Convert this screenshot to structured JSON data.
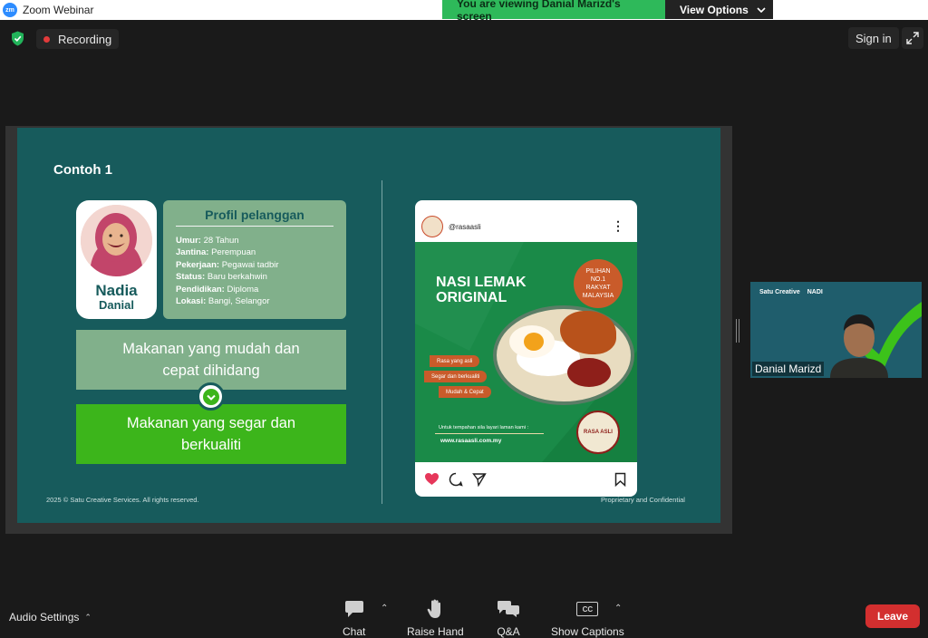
{
  "window": {
    "title": "Zoom Webinar",
    "logo_text": "zm"
  },
  "banner": {
    "viewing_text": "You are viewing Danial Marizd's screen",
    "view_options_label": "View Options"
  },
  "topbar": {
    "recording_label": "Recording",
    "signin_label": "Sign in"
  },
  "slide": {
    "title": "Contoh 1",
    "persona": {
      "first_name": "Nadia",
      "last_name": "Danial"
    },
    "profile": {
      "heading": "Profil pelanggan",
      "rows": [
        {
          "label": "Umur:",
          "value": "28 Tahun"
        },
        {
          "label": "Jantina:",
          "value": "Perempuan"
        },
        {
          "label": "Pekerjaan:",
          "value": "Pegawai tadbir"
        },
        {
          "label": "Status:",
          "value": "Baru berkahwin"
        },
        {
          "label": "Pendidikan:",
          "value": "Diploma"
        },
        {
          "label": "Lokasi:",
          "value": "Bangi, Selangor"
        }
      ]
    },
    "box_before": "Makanan yang mudah dan cepat dihidang",
    "box_after": "Makanan yang segar dan berkualiti",
    "copyright": "2025 © Satu Creative Services. All rights reserved.",
    "proprietary": "Proprietary and Confidential",
    "post": {
      "username": "@rasaasli",
      "title_line1": "NASI LEMAK",
      "title_line2": "ORIGINAL",
      "badge": "PILIHAN NO.1 RAKYAT MALAYSIA",
      "tags": [
        "Rasa yang asli",
        "Segar dan berkualiti",
        "Mudah & Cepat"
      ],
      "order_text": "Untuk tempahan sila layari laman kami :",
      "url": "www.rasaasli.com.my",
      "stamp": "RASA ASLI"
    }
  },
  "participant": {
    "name": "Danial Marizd",
    "logos": [
      "Satu Creative",
      "NADI"
    ]
  },
  "toolbar": {
    "audio_settings": "Audio Settings",
    "chat": "Chat",
    "raise_hand": "Raise Hand",
    "qa": "Q&A",
    "captions": "Show Captions",
    "captions_icon_text": "CC",
    "leave": "Leave"
  },
  "colors": {
    "accent_green": "#2eb95a",
    "slide_teal": "#175b5c",
    "box_sage": "#81b08b",
    "box_green": "#3cb51b",
    "leave_red": "#d32f2f",
    "post_green": "#1a8a48",
    "post_orange": "#c95b2a"
  },
  "icons": [
    "shield-check-icon",
    "fullscreen-icon",
    "chat-icon",
    "hand-icon",
    "qa-icon",
    "captions-icon",
    "heart-icon",
    "comment-icon",
    "share-icon",
    "bookmark-icon",
    "check-icon",
    "more-icon"
  ]
}
